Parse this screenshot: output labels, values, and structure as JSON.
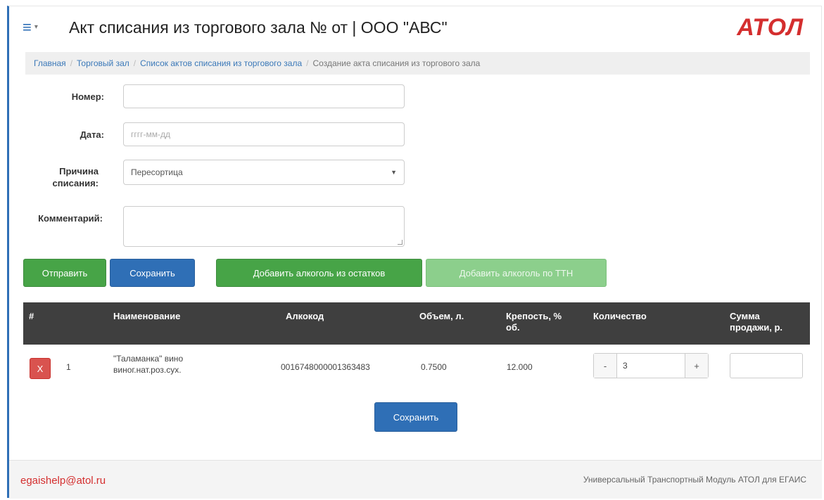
{
  "header": {
    "menu_icon": "hamburger-icon",
    "title": "Акт списания из торгового зала № от | ООО \"АВС\"",
    "logo": "АТОЛ"
  },
  "breadcrumb": {
    "items": [
      "Главная",
      "Торговый зал",
      "Список актов списания из торгового зала"
    ],
    "current": "Создание акта списания из торгового зала"
  },
  "form": {
    "number_label": "Номер:",
    "number_value": "",
    "date_label": "Дата:",
    "date_placeholder": "гггг-мм-дд",
    "reason_label_line1": "Причина",
    "reason_label_line2": "списания:",
    "reason_value": "Пересортица",
    "comment_label": "Комментарий:",
    "comment_value": ""
  },
  "actions": {
    "send": "Отправить",
    "save": "Сохранить",
    "add_from_stock": "Добавить алкоголь из остатков",
    "add_by_ttn": "Добавить алкоголь по ТТН"
  },
  "table": {
    "headers": {
      "num": "#",
      "name": "Наименование",
      "alcocode": "Алкокод",
      "volume": "Объем, л.",
      "strength_line1": "Крепость, %",
      "strength_line2": "об.",
      "quantity": "Количество",
      "sum_line1": "Сумма",
      "sum_line2": "продажи, р."
    },
    "rows": [
      {
        "delete": "X",
        "num": "1",
        "name_line1": "\"Таламанка\" вино",
        "name_line2": "виног.нат.роз.сух.",
        "alcocode": "0016748000001363483",
        "volume": "0.7500",
        "strength": "12.000",
        "minus": "-",
        "quantity": "3",
        "plus": "+",
        "sum": ""
      }
    ]
  },
  "bottom_save": "Сохранить",
  "footer": {
    "email": "egaishelp@atol.ru",
    "text": "Универсальный Транспортный Модуль АТОЛ для ЕГАИС"
  },
  "colors": {
    "accent_blue": "#2f6fb6",
    "green": "#47a447",
    "red": "#d42e2e",
    "table_header": "#3f3f3f"
  }
}
